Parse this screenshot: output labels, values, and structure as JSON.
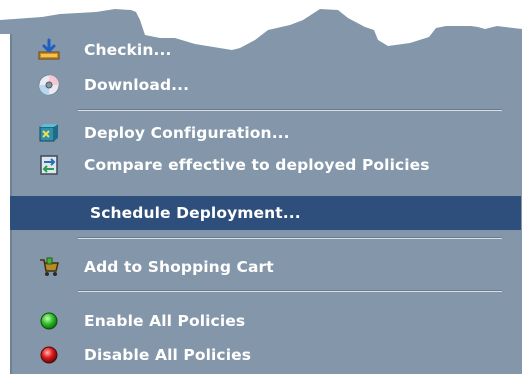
{
  "menu": {
    "items": [
      {
        "label": "Checkin...",
        "icon": "checkin-icon",
        "selected": false
      },
      {
        "label": "Download...",
        "icon": "download-disc-icon",
        "selected": false
      },
      {
        "type": "separator"
      },
      {
        "label": "Deploy Configuration...",
        "icon": "deploy-icon",
        "selected": false
      },
      {
        "label": "Compare effective to deployed Policies",
        "icon": "compare-icon",
        "selected": false
      },
      {
        "label": "Schedule Deployment...",
        "icon": "",
        "selected": true
      },
      {
        "type": "separator"
      },
      {
        "label": "Add to Shopping Cart",
        "icon": "shopping-cart-icon",
        "selected": false
      },
      {
        "type": "separator"
      },
      {
        "label": "Enable All Policies",
        "icon": "green-dot-icon",
        "selected": false
      },
      {
        "label": "Disable All Policies",
        "icon": "red-dot-icon",
        "selected": false
      }
    ]
  },
  "colors": {
    "menu_background": "#8497aa",
    "selected_background": "#2e4f7c",
    "text": "#ffffff"
  }
}
